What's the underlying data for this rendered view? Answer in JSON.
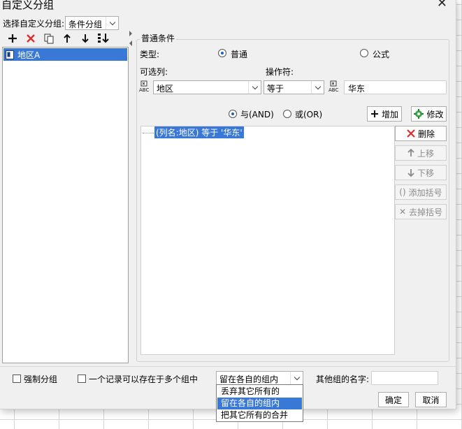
{
  "window": {
    "title": "自定义分组",
    "close_glyph": "✕"
  },
  "group_select": {
    "label": "选择自定义分组:",
    "value": "条件分组"
  },
  "tree": {
    "items": [
      {
        "label": "地区A",
        "selected": true
      }
    ]
  },
  "condition": {
    "group_title": "普通条件",
    "type_label": "类型:",
    "type_options": [
      {
        "label": "普通",
        "checked": true
      },
      {
        "label": "公式",
        "checked": false
      }
    ],
    "column_label": "可选列:",
    "operator_label": "操作符:",
    "column_value": "地区",
    "operator_value": "等于",
    "value": "华东",
    "logic_options": [
      {
        "label": "与(AND)",
        "checked": true
      },
      {
        "label": "或(OR)",
        "checked": false
      }
    ],
    "add_label": "增加",
    "modify_label": "修改",
    "items": [
      "(列名:地区) 等于 '华东'"
    ],
    "buttons": {
      "delete": "删除",
      "up": "上移",
      "down": "下移",
      "add_bracket": "添加括号",
      "remove_bracket": "去掉括号"
    }
  },
  "footer": {
    "force_group_label": "强制分组",
    "multi_group_label": "一个记录可以存在于多个组中",
    "others_select": {
      "value": "留在各自的组内",
      "options": [
        "丢弃其它所有的",
        "留在各自的组内",
        "把其它所有的合并"
      ],
      "selected_index": 1
    },
    "other_group_name_label": "其他组的名字:",
    "other_group_name_value": "",
    "ok_label": "确定",
    "cancel_label": "取消"
  },
  "colors": {
    "selection": "#3a78d8",
    "delete_red": "#d9322b",
    "radio_dot": "#1e5fbf"
  }
}
